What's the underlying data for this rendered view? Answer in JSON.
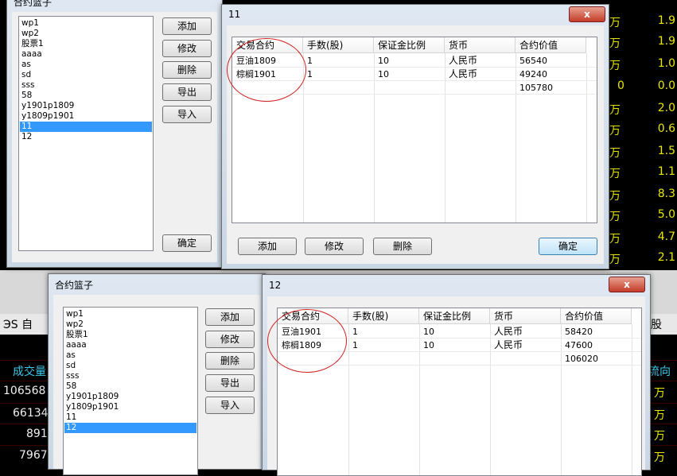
{
  "colors": {
    "accent": "#3399ff",
    "annotation": "#d02020",
    "bg_text": "#e8e800"
  },
  "background": {
    "right_rows": [
      {
        "wan": "万",
        "num": "1.9"
      },
      {
        "wan": "万",
        "num": "1.9"
      },
      {
        "wan": "万",
        "num": "1.0"
      },
      {
        "wan": "0",
        "num": "0.0"
      },
      {
        "wan": "万",
        "num": "2.0"
      },
      {
        "wan": "万",
        "num": "0.6"
      },
      {
        "wan": "万",
        "num": "1.5"
      },
      {
        "wan": "万",
        "num": "1.1"
      },
      {
        "wan": "万",
        "num": "8.3"
      },
      {
        "wan": "万",
        "num": "5.0"
      },
      {
        "wan": "万",
        "num": "4.7"
      },
      {
        "wan": "万",
        "num": "2.1"
      }
    ],
    "menu_left": "ЭS  自",
    "menu_right": "股",
    "col_left": "成交量",
    "col_right": "流向",
    "left_values": [
      "106568",
      "66134",
      "891",
      "7967"
    ],
    "right_values": [
      "万",
      "万",
      "万",
      "万"
    ]
  },
  "basket1": {
    "title": "合约篮子",
    "items": [
      "wp1",
      "wp2",
      "股票1",
      "aaaa",
      "as",
      "sd",
      "sss",
      "58",
      "y1901p1809",
      "y1809p1901",
      "11",
      "12"
    ],
    "selected": "11",
    "buttons": {
      "add": "添加",
      "edit": "修改",
      "delete": "删除",
      "export": "导出",
      "import": "导入",
      "ok": "确定"
    }
  },
  "detail11": {
    "title": "11",
    "close": "x",
    "columns": [
      "交易合约",
      "手数(股)",
      "保证金比例",
      "货币",
      "合约价值"
    ],
    "rows": [
      [
        "豆油1809",
        "1",
        "10",
        "人民币",
        "56540"
      ],
      [
        "棕榈1901",
        "1",
        "10",
        "人民币",
        "49240"
      ]
    ],
    "total": "105780",
    "buttons": {
      "add": "添加",
      "edit": "修改",
      "delete": "删除",
      "ok": "确定"
    }
  },
  "basket2": {
    "title": "合约篮子",
    "items": [
      "wp1",
      "wp2",
      "股票1",
      "aaaa",
      "as",
      "sd",
      "sss",
      "58",
      "y1901p1809",
      "y1809p1901",
      "11",
      "12"
    ],
    "selected": "12",
    "buttons": {
      "add": "添加",
      "edit": "修改",
      "delete": "删除",
      "export": "导出",
      "import": "导入"
    }
  },
  "detail12": {
    "title": "12",
    "close": "x",
    "columns": [
      "交易合约",
      "手数(股)",
      "保证金比例",
      "货币",
      "合约价值"
    ],
    "rows": [
      [
        "豆油1901",
        "1",
        "10",
        "人民币",
        "58420"
      ],
      [
        "棕榈1809",
        "1",
        "10",
        "人民币",
        "47600"
      ]
    ],
    "total": "106020"
  }
}
